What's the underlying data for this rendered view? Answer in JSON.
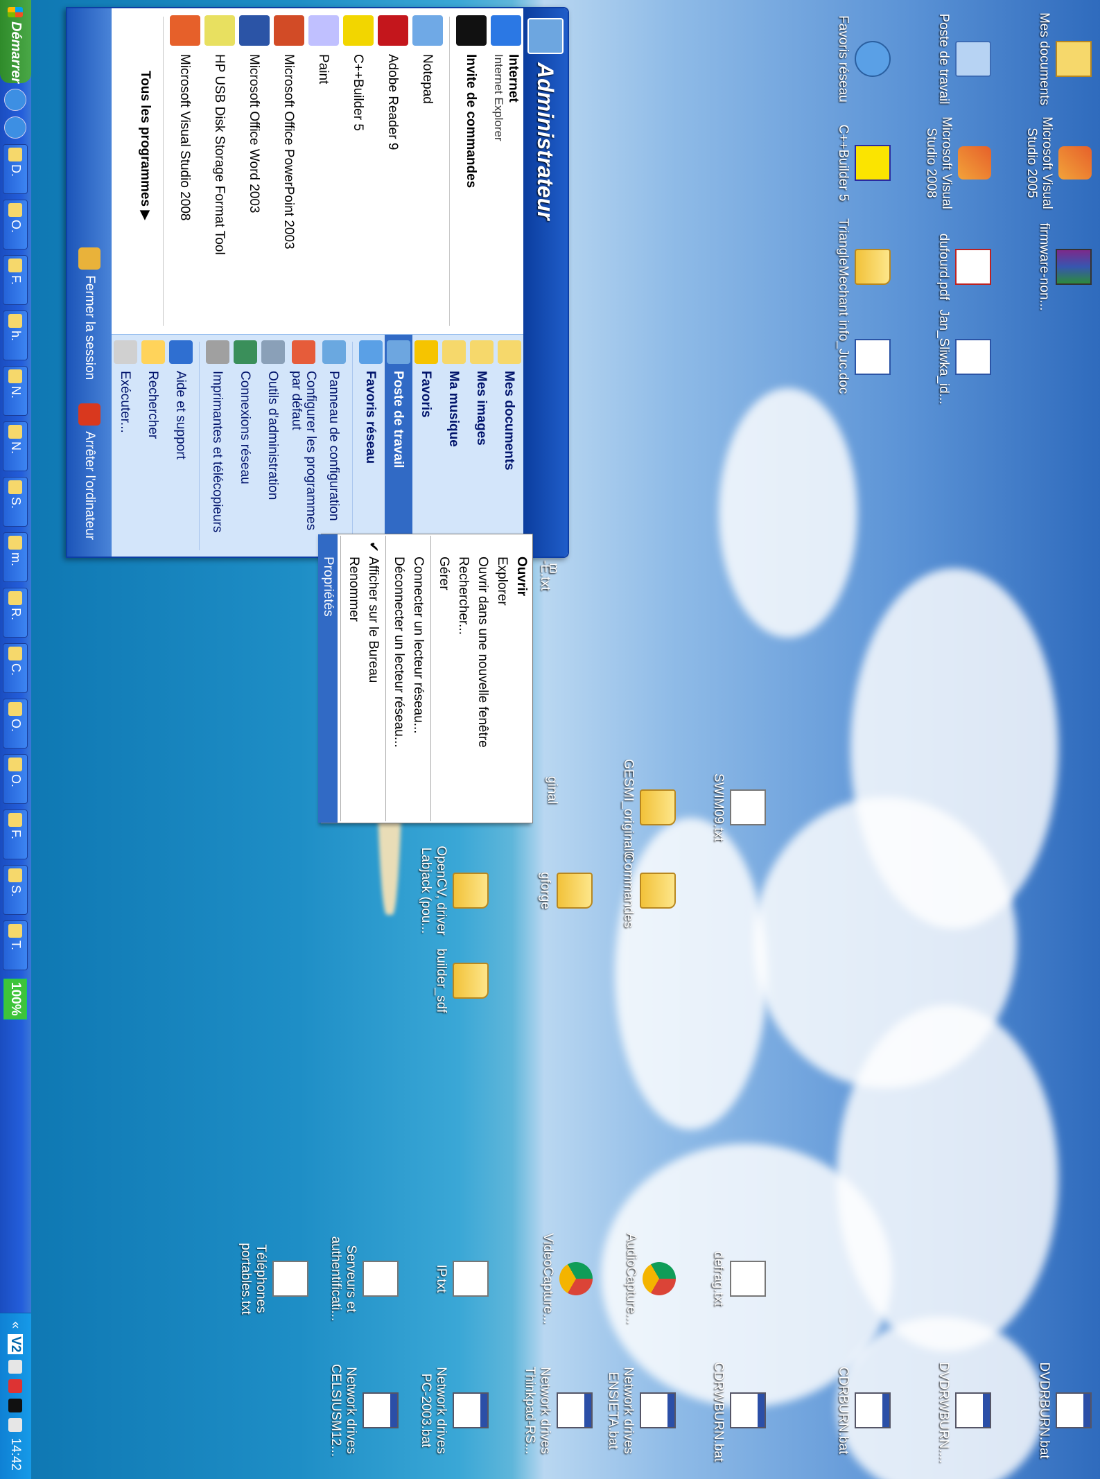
{
  "user": "Administrateur",
  "pinned": [
    {
      "title": "Internet",
      "sub": "Internet Explorer",
      "icon": "ie-icon"
    },
    {
      "title": "Invite de commandes",
      "sub": "",
      "icon": "cmd-icon"
    }
  ],
  "recent": [
    {
      "label": "Notepad",
      "icon": "notepad-icon"
    },
    {
      "label": "Adobe Reader 9",
      "icon": "adobe-reader-icon"
    },
    {
      "label": "C++Builder 5",
      "icon": "cpp-builder-icon"
    },
    {
      "label": "Paint",
      "icon": "paint-icon"
    },
    {
      "label": "Microsoft Office PowerPoint 2003",
      "icon": "powerpoint-icon"
    },
    {
      "label": "Microsoft Office Word 2003",
      "icon": "word-icon"
    },
    {
      "label": "HP USB Disk Storage Format Tool",
      "icon": "usb-tool-icon"
    },
    {
      "label": "Microsoft Visual Studio 2008",
      "icon": "visual-studio-icon"
    }
  ],
  "all_programs": "Tous les programmes",
  "right_items": [
    {
      "label": "Mes documents",
      "bold": true,
      "icon": "my-documents-icon"
    },
    {
      "label": "Mes images",
      "bold": true,
      "icon": "my-pictures-icon"
    },
    {
      "label": "Ma musique",
      "bold": true,
      "icon": "my-music-icon"
    },
    {
      "label": "Favoris",
      "bold": true,
      "icon": "favorites-icon"
    },
    {
      "label": "Poste de travail",
      "bold": true,
      "icon": "my-computer-icon",
      "selected": true
    },
    {
      "label": "Favoris réseau",
      "bold": true,
      "icon": "network-places-icon"
    },
    {
      "label": "Panneau de configuration",
      "bold": false,
      "icon": "control-panel-icon"
    },
    {
      "label": "Configurer les programmes par défaut",
      "bold": false,
      "icon": "default-programs-icon"
    },
    {
      "label": "Outils d'administration",
      "bold": false,
      "icon": "admin-tools-icon"
    },
    {
      "label": "Connexions réseau",
      "bold": false,
      "icon": "network-connections-icon"
    },
    {
      "label": "Imprimantes et télécopieurs",
      "bold": false,
      "icon": "printers-icon"
    },
    {
      "label": "Aide et support",
      "bold": false,
      "icon": "help-icon"
    },
    {
      "label": "Rechercher",
      "bold": false,
      "icon": "search-icon"
    },
    {
      "label": "Exécuter...",
      "bold": false,
      "icon": "run-icon"
    }
  ],
  "footer": {
    "logoff": "Fermer la session",
    "shutdown": "Arrêter l'ordinateur"
  },
  "context_menu": [
    {
      "label": "Ouvrir",
      "bold": true
    },
    {
      "label": "Explorer"
    },
    {
      "label": "Ouvrir dans une nouvelle fenêtre"
    },
    {
      "label": "Rechercher..."
    },
    {
      "label": "Gérer"
    },
    {
      "sep": true
    },
    {
      "label": "Connecter un lecteur réseau..."
    },
    {
      "label": "Déconnecter un lecteur réseau..."
    },
    {
      "sep": true
    },
    {
      "label": "Afficher sur le Bureau",
      "checked": true
    },
    {
      "label": "Renommer"
    },
    {
      "sep": true
    },
    {
      "label": "Propriétés",
      "selected": true
    }
  ],
  "desktop_icons": [
    {
      "label": "Mes documents",
      "icon": "docs"
    },
    {
      "label": "Poste de travail",
      "icon": "comp"
    },
    {
      "label": "Favoris réseau",
      "icon": "net"
    },
    {
      "label": "Microsoft Visual Studio 2005",
      "icon": "vs"
    },
    {
      "label": "Microsoft Visual Studio 2008",
      "icon": "vs"
    },
    {
      "label": "C++Builder 5",
      "icon": "cpp"
    },
    {
      "label": "firmware-non...",
      "icon": "rar"
    },
    {
      "label": "dufourd.pdf",
      "icon": "pdf"
    },
    {
      "label": "TriangleMechant",
      "icon": "folder"
    },
    {
      "label": "Jan_Sliwka_id...",
      "icon": "word"
    },
    {
      "label": "info_Juc.doc",
      "icon": "word"
    },
    {
      "label": "SWIM09.txt",
      "icon": "doc"
    },
    {
      "label": "GESMI_original0",
      "icon": "folder"
    },
    {
      "label": "Commandes",
      "icon": "folder"
    },
    {
      "label": "gforge",
      "icon": "folder"
    },
    {
      "label": "OpenCV, driver Labjack (pou...",
      "icon": "folder"
    },
    {
      "label": "builder_sdf",
      "icon": "folder"
    },
    {
      "label": "defrag.txt",
      "icon": "doc"
    },
    {
      "label": "AudioCapture...",
      "icon": "chrome"
    },
    {
      "label": "VideoCapture...",
      "icon": "chrome"
    },
    {
      "label": "IP.txt",
      "icon": "doc"
    },
    {
      "label": "Serveurs et authentificati...",
      "icon": "doc"
    },
    {
      "label": "Téléphones portables.txt",
      "icon": "doc"
    },
    {
      "label": "DVDRBURN.bat",
      "icon": "bat"
    },
    {
      "label": "DVDRWBURN....",
      "icon": "bat"
    },
    {
      "label": "CDRBURN.bat",
      "icon": "bat"
    },
    {
      "label": "CDRWBURN.bat",
      "icon": "bat"
    },
    {
      "label": "Network drives ENSIETA.bat",
      "icon": "bat"
    },
    {
      "label": "Network drives Thinkpad-RS...",
      "icon": "bat"
    },
    {
      "label": "Network drives PC-2003.bat",
      "icon": "bat"
    },
    {
      "label": "Network drives CELSIUSM12...",
      "icon": "bat"
    }
  ],
  "partial_labels": [
    "m",
    "-E.txt",
    "ginal"
  ],
  "taskbar": {
    "start": "Démarrer",
    "buttons": [
      "D.",
      "O.",
      "F.",
      "h.",
      "N.",
      "N.",
      "S.",
      "m.",
      "R.",
      "C.",
      "O.",
      "O.",
      "F.",
      "S.",
      "T."
    ],
    "battery": "100%",
    "tray_text": "V2",
    "clock": "14:42"
  }
}
